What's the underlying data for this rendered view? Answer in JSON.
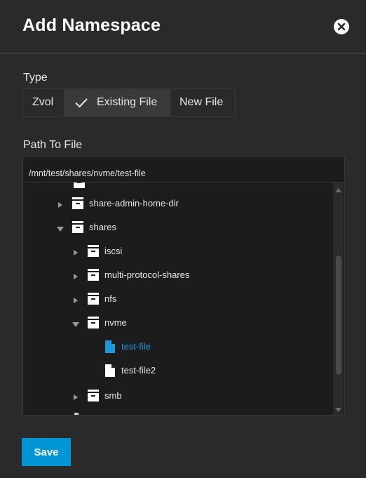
{
  "dialog": {
    "title": "Add Namespace",
    "close_icon": "close-icon"
  },
  "type_field": {
    "label": "Type",
    "options": [
      {
        "label": "Zvol",
        "selected": false
      },
      {
        "label": "Existing File",
        "selected": true
      },
      {
        "label": "New File",
        "selected": false
      }
    ]
  },
  "path_field": {
    "label": "Path To File",
    "value": "/mnt/test/shares/nvme/test-file"
  },
  "tree": {
    "items": [
      {
        "label": "share-admin-home-dir",
        "kind": "folder",
        "expanded": false,
        "selected": false
      },
      {
        "label": "shares",
        "kind": "folder",
        "expanded": true,
        "selected": false
      },
      {
        "label": "iscsi",
        "kind": "folder",
        "expanded": false,
        "selected": false
      },
      {
        "label": "multi-protocol-shares",
        "kind": "folder",
        "expanded": false,
        "selected": false
      },
      {
        "label": "nfs",
        "kind": "folder",
        "expanded": false,
        "selected": false
      },
      {
        "label": "nvme",
        "kind": "folder",
        "expanded": true,
        "selected": false
      },
      {
        "label": "test-file",
        "kind": "file",
        "expanded": false,
        "selected": true
      },
      {
        "label": "test-file2",
        "kind": "file",
        "expanded": false,
        "selected": false
      },
      {
        "label": "smb",
        "kind": "folder",
        "expanded": false,
        "selected": false
      }
    ]
  },
  "actions": {
    "save_label": "Save"
  },
  "colors": {
    "accent": "#0095d5",
    "selected_text": "#1e98d8",
    "background": "#2a2a2a",
    "input_background": "#1c1c1c"
  }
}
